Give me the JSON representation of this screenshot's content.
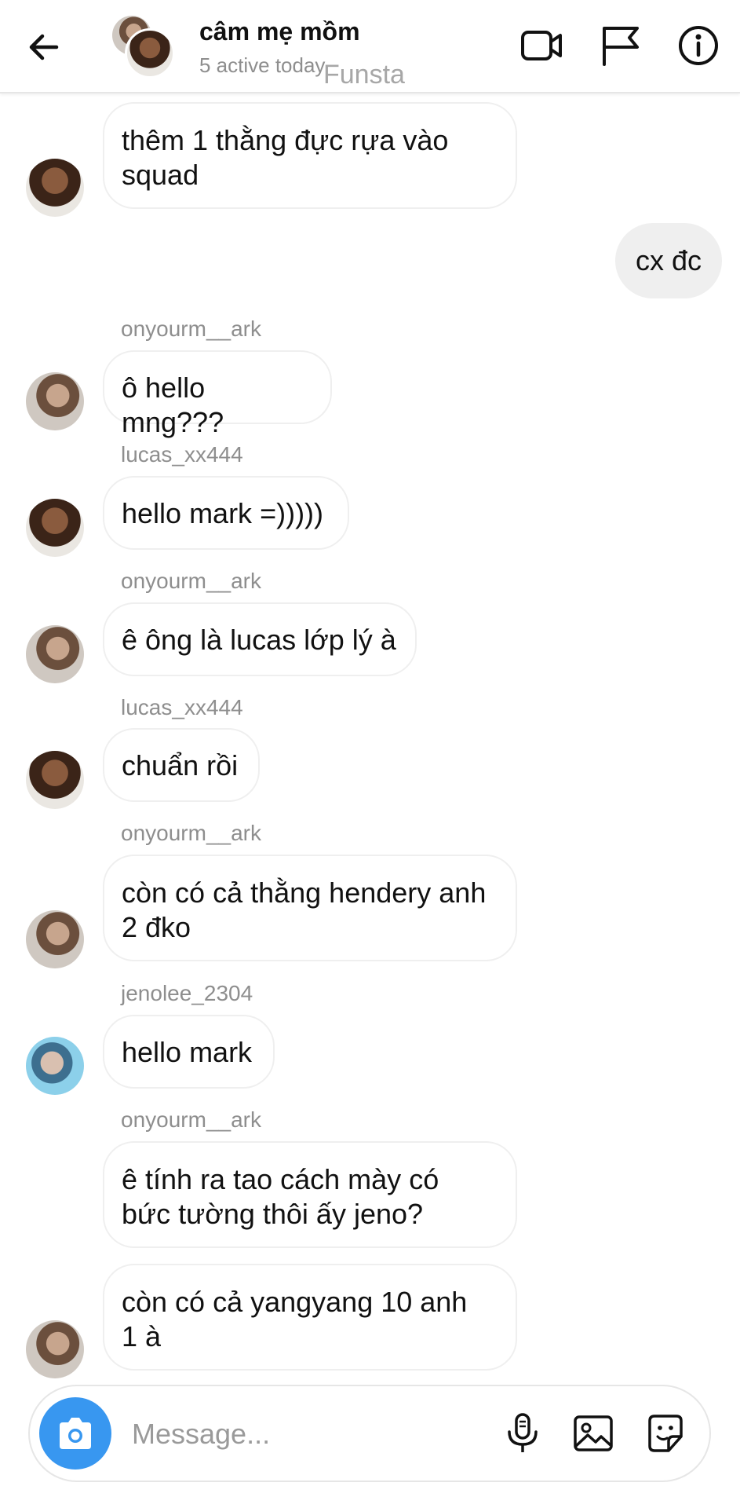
{
  "header": {
    "title": "câm mẹ mồm",
    "status": "5 active today",
    "watermark": "Funsta"
  },
  "messages": [
    {
      "type": "in",
      "text": "thêm 1 thằng đực rựa vào\nsquad"
    },
    {
      "type": "out",
      "text": "cx đc"
    },
    {
      "type": "in",
      "sender": "onyourm__ark",
      "text": "ô hello mng???"
    },
    {
      "type": "in",
      "sender": "lucas_xx444",
      "text": "hello mark =)))))"
    },
    {
      "type": "in",
      "sender": "onyourm__ark",
      "text": "ê ông là lucas lớp lý à"
    },
    {
      "type": "in",
      "sender": "lucas_xx444",
      "text": "chuẩn rồi"
    },
    {
      "type": "in",
      "sender": "onyourm__ark",
      "text": "còn có cả thằng hendery anh\n2 đko"
    },
    {
      "type": "in",
      "sender": "jenolee_2304",
      "text": "hello mark"
    },
    {
      "type": "in",
      "sender": "onyourm__ark",
      "text": "ê tính ra tao cách mày có\nbức tường thôi ấy jeno?"
    },
    {
      "type": "in",
      "text": "còn có cả yangyang 10 anh\n1 à"
    }
  ],
  "composer": {
    "placeholder": "Message..."
  },
  "icons": {
    "back": "arrow-left-icon",
    "video": "video-call-icon",
    "flag": "flag-icon",
    "info": "info-icon",
    "camera": "camera-icon",
    "mic": "microphone-icon",
    "gallery": "image-gallery-icon",
    "sticker": "sticker-icon"
  },
  "colors": {
    "accent": "#3897f0",
    "outgoing_bubble": "#efefef",
    "secondary_text": "#8e8e8e"
  }
}
